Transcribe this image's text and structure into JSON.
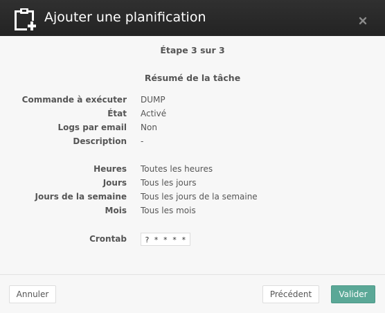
{
  "dialog": {
    "title": "Ajouter une planification",
    "title_icon": "clipboard-plus-icon",
    "close_icon": "close-icon"
  },
  "wizard": {
    "step_text": "Étape 3 sur 3",
    "summary_title": "Résumé de la tâche"
  },
  "task": [
    {
      "label": "Commande à exécuter",
      "value": "DUMP"
    },
    {
      "label": "État",
      "value": "Activé"
    },
    {
      "label": "Logs par email",
      "value": "Non"
    },
    {
      "label": "Description",
      "value": "-"
    }
  ],
  "schedule": [
    {
      "label": "Heures",
      "value": "Toutes les heures"
    },
    {
      "label": "Jours",
      "value": "Tous les jours"
    },
    {
      "label": "Jours de la semaine",
      "value": "Tous les jours de la semaine"
    },
    {
      "label": "Mois",
      "value": "Tous les mois"
    }
  ],
  "crontab": {
    "label": "Crontab",
    "value": "? * * * *"
  },
  "footer": {
    "cancel_label": "Annuler",
    "previous_label": "Précédent",
    "submit_label": "Valider"
  },
  "colors": {
    "header_bg": "#2b2b2b",
    "primary_button": "#5ba897"
  }
}
